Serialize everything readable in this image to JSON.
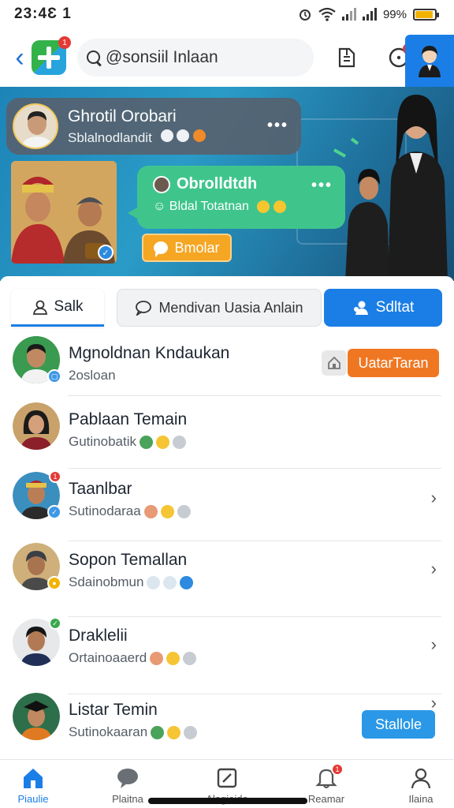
{
  "status_bar": {
    "time": "23:4Ɛ 1",
    "battery": "99%"
  },
  "header": {
    "logo_badge": "1",
    "search_text": "@sonsiil Inlaan",
    "bell_badge": "0"
  },
  "hero": {
    "card1_title": "Ghrotil Orobari",
    "card1_sub": "Sblalnodlandit",
    "card2_title": "Obrolldtdh",
    "card2_sub": "Bldal Totatnan",
    "button_label": "Bmolar",
    "more": "•••"
  },
  "tabs": [
    {
      "label": "Salk"
    },
    {
      "label": "Mendivan Uasia Anlain"
    },
    {
      "label": "Sdltat"
    }
  ],
  "contacts": [
    {
      "name": "Mgnoldnan Kndaukan",
      "sub": "2osloan",
      "action": "UatarTaran"
    },
    {
      "name": "Pablaan Temain",
      "sub": "Gutinobatik"
    },
    {
      "name": "Taanlbar",
      "sub": "Sutinodaraa",
      "badge": "1"
    },
    {
      "name": "Sopon Temallan",
      "sub": "Sdainobmun"
    },
    {
      "name": "Draklelii",
      "sub": "Ortainoaaerd"
    },
    {
      "name": "Listar Temin",
      "sub": "Sutinokaaran",
      "action": "Stallole"
    }
  ],
  "bottom_nav": [
    {
      "label": "Piaulie"
    },
    {
      "label": "Plaitna"
    },
    {
      "label": "Alogioido"
    },
    {
      "label": "Reamar",
      "badge": "1"
    },
    {
      "label": "Ilaina"
    }
  ],
  "colors": {
    "primary": "#1a7ee6",
    "green": "#3fc58c",
    "orange": "#f07722",
    "alert": "#e53935"
  }
}
